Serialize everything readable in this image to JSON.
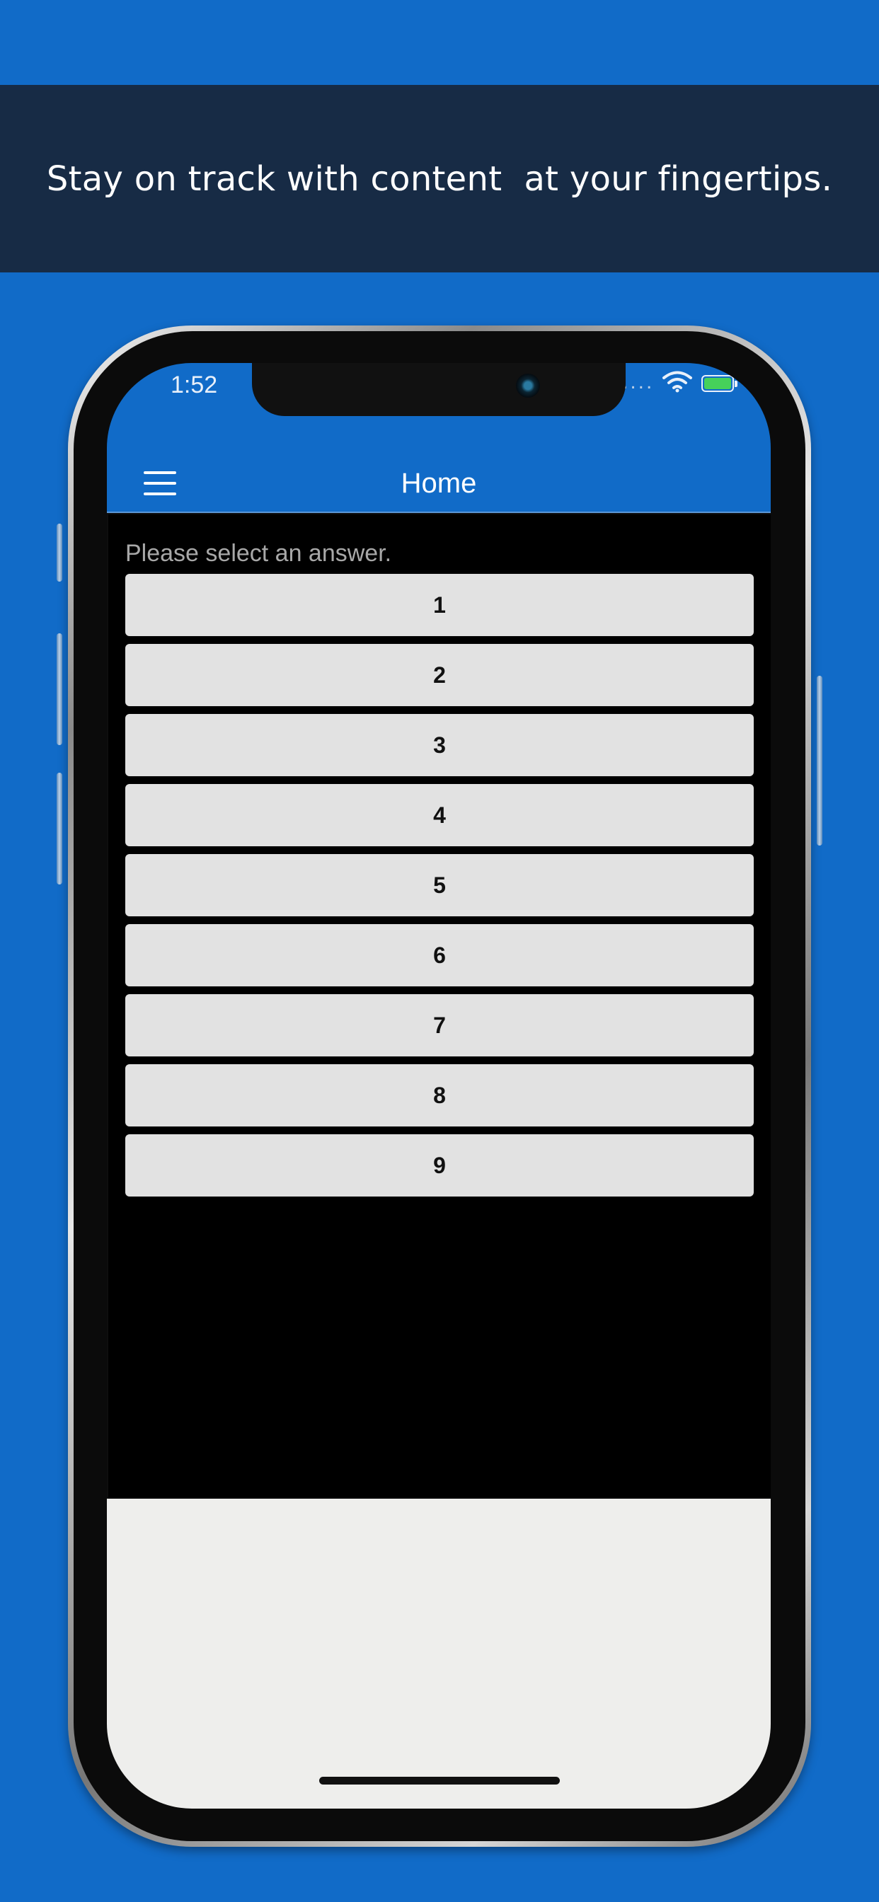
{
  "banner": {
    "tagline": "Stay on track with content  at your fingertips."
  },
  "status_bar": {
    "time": "1:52",
    "dots": "....",
    "wifi_icon": "wifi-icon",
    "battery_icon": "battery-charging-icon"
  },
  "nav": {
    "title": "Home",
    "menu_icon": "hamburger-menu-icon"
  },
  "content": {
    "prompt": "Please select an answer.",
    "answers": [
      "1",
      "2",
      "3",
      "4",
      "5",
      "6",
      "7",
      "8",
      "9"
    ]
  },
  "colors": {
    "background": "#116bc8",
    "banner": "#172b45",
    "button": "#e2e2e2",
    "content_bg": "#000000",
    "footer_bg": "#eeeeec"
  }
}
